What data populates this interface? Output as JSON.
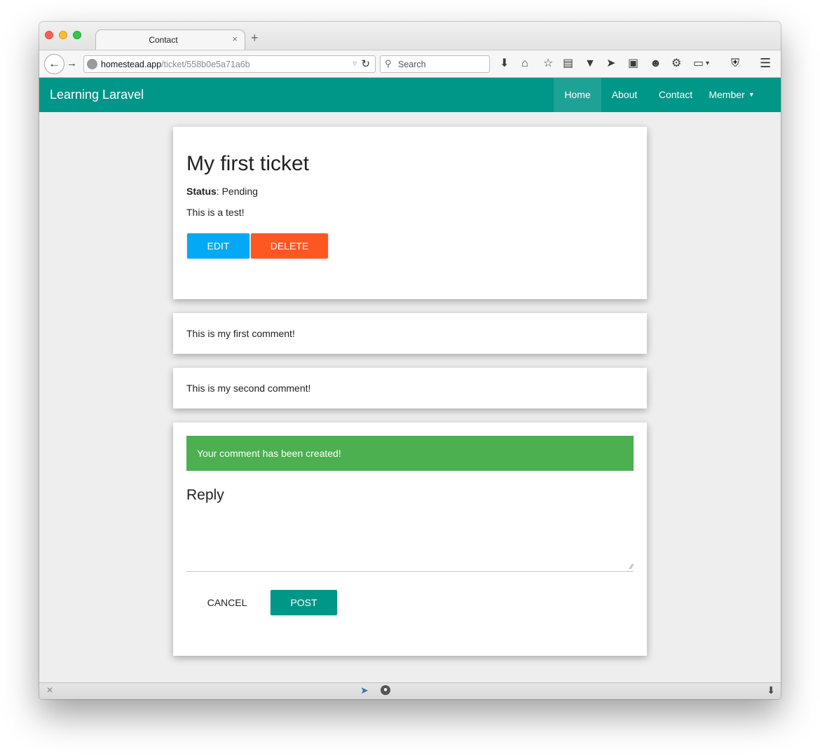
{
  "browser": {
    "tab_title": "Contact",
    "tab_close": "×",
    "new_tab": "+",
    "url_host": "homestead.app",
    "url_path": "/ticket/558b0e5a71a6b",
    "search_placeholder": "Search"
  },
  "navbar": {
    "brand": "Learning Laravel",
    "items": [
      "Home",
      "About",
      "Contact",
      "Member"
    ],
    "active": "Home",
    "color": "#009688"
  },
  "ticket": {
    "title": "My first ticket",
    "status_label": "Status",
    "status_value": ": Pending",
    "body": "This is a test!",
    "edit_label": "EDIT",
    "delete_label": "DELETE"
  },
  "comments": [
    {
      "text": "This is my first comment!"
    },
    {
      "text": "This is my second comment!"
    }
  ],
  "reply": {
    "alert": "Your comment has been created!",
    "title": "Reply",
    "textarea_value": "",
    "cancel_label": "CANCEL",
    "post_label": "POST"
  },
  "colors": {
    "primary": "#009688",
    "edit": "#03a9f4",
    "delete": "#ff5722",
    "success": "#4caf50"
  }
}
